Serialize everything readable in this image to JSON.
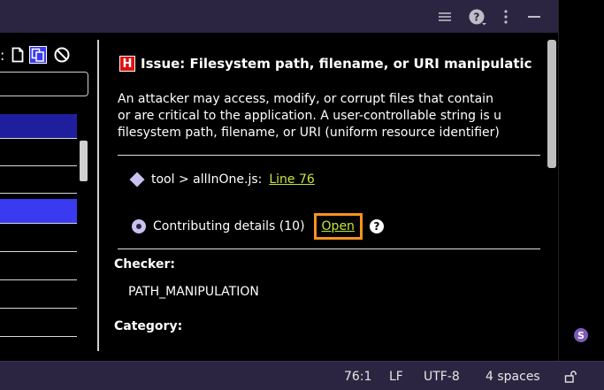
{
  "left_toolbar": {
    "colon": ":",
    "icons": [
      "file-icon",
      "copy-files-icon",
      "no-entry-icon"
    ]
  },
  "issue": {
    "severity_letter": "H",
    "title": "Issue: Filesystem path, filename, or URI manipulatic",
    "description_lines": [
      "An attacker may access, modify, or corrupt files that contain",
      "or are critical to the application. A user-controllable string is u",
      "filesystem path, filename, or URI (uniform resource identifier)"
    ],
    "location_text": "tool > allInOne.js:",
    "location_link": "Line 76",
    "contributing_text": "Contributing details (10)",
    "open_link": "Open",
    "help_glyph": "?"
  },
  "sections": [
    {
      "header": "Checker:",
      "value": "PATH_MANIPULATION"
    },
    {
      "header": "Category:",
      "value": ""
    }
  ],
  "statusbar": {
    "position": "76:1",
    "line_ending": "LF",
    "encoding": "UTF-8",
    "indent": "4 spaces"
  },
  "badge": {
    "letter": "S"
  },
  "colors": {
    "titlebar_bg": "#2c2541",
    "selection_dark": "#1f1f9e",
    "selection_bright": "#3a3af0",
    "severity_red": "#dd1111",
    "link_lime": "#c4e53a",
    "highlight_orange": "#f7931e"
  }
}
